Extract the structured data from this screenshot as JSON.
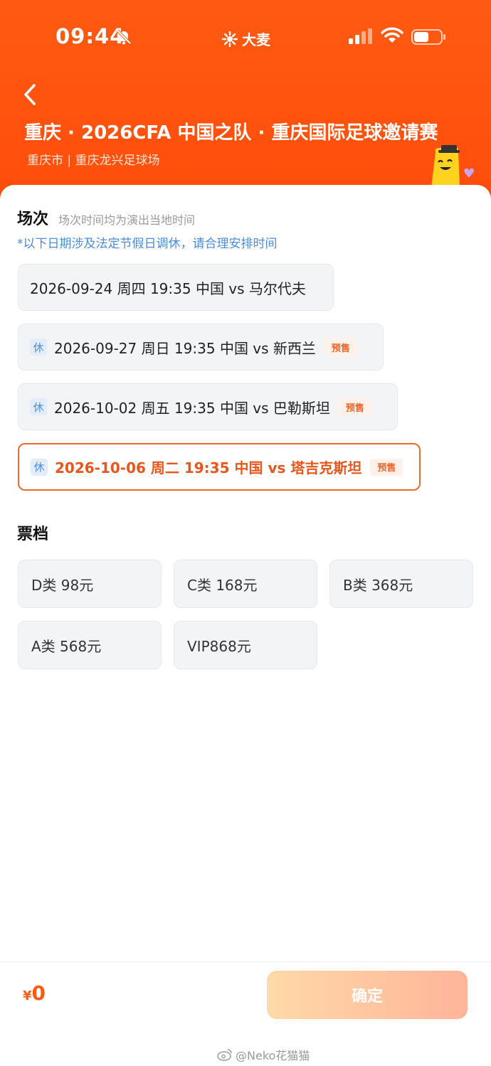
{
  "status_bar": {
    "time": "09:44",
    "brand": "大麦"
  },
  "header": {
    "title": "重庆 · 2026CFA 中国之队 · 重庆国际足球邀请赛",
    "subtitle": "重庆市 | 重庆龙兴足球场"
  },
  "sessions_section": {
    "heading": "场次",
    "note": "场次时间均为演出当地时间",
    "holiday_note": "*以下日期涉及法定节假日调休，请合理安排时间",
    "items": [
      {
        "text": "2026-09-24  周四 19:35 中国 vs 马尔代夫",
        "holiday_tag": "",
        "presale_tag": "",
        "selected": false
      },
      {
        "text": "2026-09-27 周日 19:35 中国 vs 新西兰",
        "holiday_tag": "休",
        "presale_tag": "预售",
        "selected": false
      },
      {
        "text": "2026-10-02 周五 19:35 中国 vs 巴勒斯坦",
        "holiday_tag": "休",
        "presale_tag": "预售",
        "selected": false
      },
      {
        "text": "2026-10-06 周二 19:35 中国 vs 塔吉克斯坦",
        "holiday_tag": "休",
        "presale_tag": "预售",
        "selected": true
      }
    ]
  },
  "tiers_section": {
    "heading": "票档",
    "items": [
      "D类 98元",
      "C类 168元",
      "B类 368元",
      "A类 568元",
      "VIP868元"
    ]
  },
  "footer": {
    "currency": "¥",
    "price": "0",
    "confirm_label": "确定"
  },
  "watermark": "@Neko花猫猫",
  "colors": {
    "brand_orange": "#ff5a12",
    "selected_text": "#e8561b",
    "holiday_blue": "#4a8ce0"
  }
}
